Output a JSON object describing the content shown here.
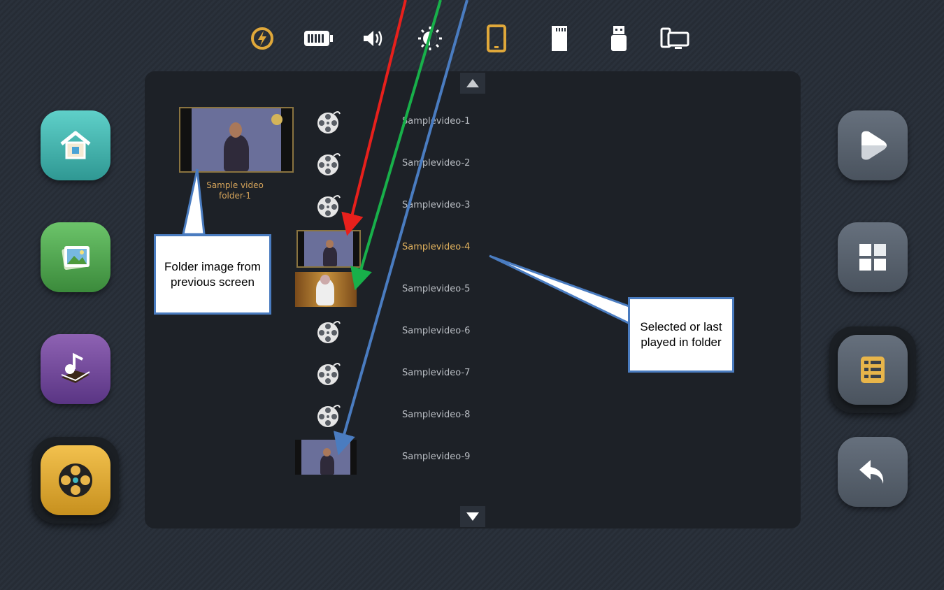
{
  "status_bar": {
    "icons": [
      "charging-icon",
      "battery-icon",
      "volume-icon",
      "brightness-icon",
      "tablet-icon",
      "sd-card-icon",
      "usb-drive-icon",
      "display-mirror-icon"
    ],
    "active_icon": "tablet-icon",
    "accent_color": "#e0a83a"
  },
  "left_nav": {
    "items": [
      {
        "name": "home",
        "icon": "home-icon"
      },
      {
        "name": "photos",
        "icon": "photos-icon"
      },
      {
        "name": "music",
        "icon": "music-book-icon"
      },
      {
        "name": "videos",
        "icon": "film-reel-icon",
        "selected": true
      }
    ]
  },
  "right_nav": {
    "items": [
      {
        "name": "play",
        "icon": "play-icon"
      },
      {
        "name": "grid-view",
        "icon": "grid-icon"
      },
      {
        "name": "list-view",
        "icon": "list-icon",
        "selected": true
      },
      {
        "name": "back",
        "icon": "back-arrow-icon"
      }
    ]
  },
  "folder": {
    "label_line1": "Sample video",
    "label_line2": "folder-1"
  },
  "videos": [
    {
      "label": "Samplevideo-1",
      "thumb": "reel"
    },
    {
      "label": "Samplevideo-2",
      "thumb": "reel"
    },
    {
      "label": "Samplevideo-3",
      "thumb": "reel"
    },
    {
      "label": "Samplevideo-4",
      "thumb": "image",
      "selected": true
    },
    {
      "label": "Samplevideo-5",
      "thumb": "image"
    },
    {
      "label": "Samplevideo-6",
      "thumb": "reel"
    },
    {
      "label": "Samplevideo-7",
      "thumb": "reel"
    },
    {
      "label": "Samplevideo-8",
      "thumb": "reel"
    },
    {
      "label": "Samplevideo-9",
      "thumb": "image"
    }
  ],
  "annotations": {
    "folder_callout": "Folder image from previous screen",
    "selected_callout": "Selected or last played in folder",
    "arrow_colors": [
      "#e8201c",
      "#18b04a",
      "#4a7cc0"
    ]
  }
}
